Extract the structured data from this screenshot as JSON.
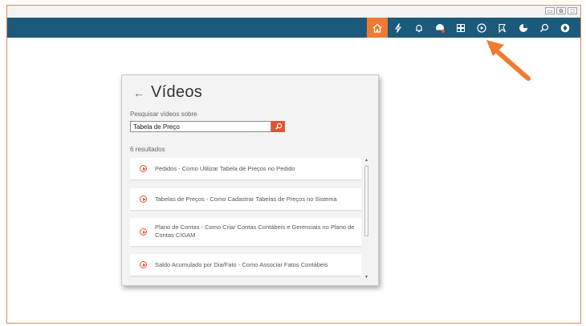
{
  "window": {
    "controls": [
      "▭",
      "⧉",
      "□"
    ]
  },
  "toolbar": {
    "icons": [
      {
        "name": "home-icon",
        "active": true
      },
      {
        "name": "lightning-icon",
        "active": false
      },
      {
        "name": "bell-icon",
        "active": false
      },
      {
        "name": "user-alert-icon",
        "active": false
      },
      {
        "name": "grid-icon",
        "active": false
      },
      {
        "name": "video-play-icon",
        "active": false
      },
      {
        "name": "bookmark-icon",
        "active": false
      },
      {
        "name": "pie-chart-icon",
        "active": false
      },
      {
        "name": "search-icon",
        "active": false
      },
      {
        "name": "settings-icon",
        "active": false
      }
    ],
    "accent_color": "#f07a31",
    "bar_color": "#1b5a7a"
  },
  "panel": {
    "back_label": "←",
    "title": "Vídeos",
    "search_label": "Pesquisar vídeos sobre",
    "search_value": "Tabela de Preço",
    "results_count": "6 resultados",
    "results": [
      {
        "label": "Pedidos - Como Utilizar Tabela de Preços no Pedido"
      },
      {
        "label": "Tabelas de Preços - Como Cadastrar Tabelas de Preços no Sistema"
      },
      {
        "label": "Plano de Contas - Como Criar Contas Contábeis e Gerenciais no Plano de Contas CIGAM"
      },
      {
        "label": "Saldo Acumulado por Dia/Fato - Como Associar Fatos Contábeis"
      }
    ]
  }
}
